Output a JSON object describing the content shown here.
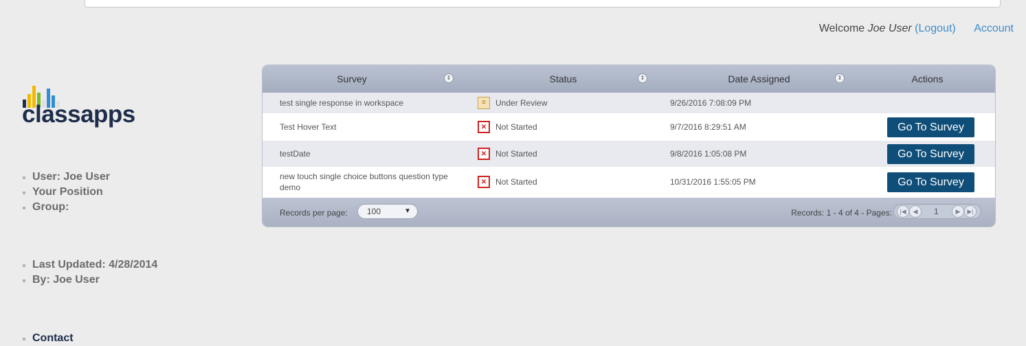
{
  "header": {
    "welcome_prefix": "Welcome",
    "user_name": "Joe User",
    "logout_label": "(Logout)",
    "account_label": "Account"
  },
  "logo": {
    "text": "classapps"
  },
  "sidebar": {
    "info": [
      "User: Joe User",
      "Your Position",
      "Group:"
    ],
    "meta": [
      "Last Updated: 4/28/2014",
      "By: Joe User"
    ],
    "links": [
      "Contact"
    ]
  },
  "grid": {
    "columns": [
      "Survey",
      "Status",
      "Date Assigned",
      "Actions"
    ],
    "rows": [
      {
        "survey": "test single response in workspace",
        "status": "Under Review",
        "status_icon": "clipboard-icon",
        "date": "9/26/2016 7:08:09 PM",
        "action": ""
      },
      {
        "survey": "Test Hover Text",
        "status": "Not Started",
        "status_icon": "not-started-icon",
        "date": "9/7/2016 8:29:51 AM",
        "action": "Go To Survey"
      },
      {
        "survey": "testDate",
        "status": "Not Started",
        "status_icon": "not-started-icon",
        "date": "9/8/2016 1:05:08 PM",
        "action": "Go To Survey"
      },
      {
        "survey": "new touch single choice buttons question type demo",
        "status": "Not Started",
        "status_icon": "not-started-icon",
        "date": "10/31/2016 1:55:05 PM",
        "action": "Go To Survey"
      }
    ],
    "footer": {
      "records_per_page_label": "Records per page:",
      "records_per_page_value": "100",
      "records_summary": "Records: 1 - 4 of 4 - Pages:",
      "current_page": "1"
    }
  },
  "colors": {
    "action_button": "#0f4e78",
    "link": "#3d8cc9",
    "not_started": "#d02020"
  }
}
